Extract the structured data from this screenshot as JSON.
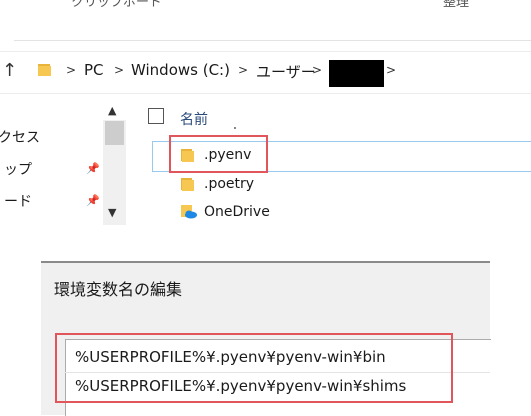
{
  "explorer": {
    "ribbon": {
      "clipboard_label": "クリップボード",
      "organize_label": "整理"
    },
    "breadcrumb": {
      "up_glyph": "↑",
      "items": [
        "PC",
        "Windows (C:)",
        "ユーザー"
      ],
      "separator": ">"
    },
    "nav_pane": {
      "items": [
        "クセス",
        "ップ",
        "ード"
      ],
      "pin_glyph": "📌"
    },
    "file_list": {
      "column_name": "名前",
      "files": [
        {
          "name": ".pyenv",
          "type": "folder",
          "highlighted": true
        },
        {
          "name": ".poetry",
          "type": "folder",
          "highlighted": false
        },
        {
          "name": "OneDrive",
          "type": "onedrive",
          "highlighted": false
        }
      ]
    }
  },
  "dialog": {
    "title": "環境変数名の編集",
    "paths": [
      "%USERPROFILE%¥.pyenv¥pyenv-win¥bin",
      "%USERPROFILE%¥.pyenv¥pyenv-win¥shims"
    ]
  },
  "colors": {
    "highlight_red": "#e0565b",
    "folder_yellow": "#f6c851",
    "onedrive_blue": "#1e88e5",
    "selection_blue": "#99c9ef"
  }
}
